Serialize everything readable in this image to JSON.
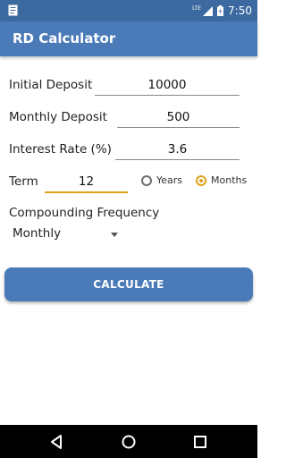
{
  "status_bar": {
    "time": "7:50",
    "network_label": "LTE",
    "icons": [
      "notification-icon",
      "signal-icon",
      "battery-icon"
    ]
  },
  "app_bar": {
    "title": "RD Calculator"
  },
  "form": {
    "initial_deposit": {
      "label": "Initial Deposit",
      "value": "10000"
    },
    "monthly_deposit": {
      "label": "Monthly Deposit",
      "value": "500"
    },
    "interest_rate": {
      "label": "Interest Rate (%)",
      "value": "3.6"
    },
    "term": {
      "label": "Term",
      "value": "12",
      "options": [
        {
          "label": "Years",
          "selected": false
        },
        {
          "label": "Months",
          "selected": true
        }
      ]
    },
    "compounding": {
      "label": "Compounding Frequency",
      "selected": "Monthly"
    }
  },
  "calculate_button": {
    "label": "CALCULATE"
  },
  "colors": {
    "status_bar": "#3c6aa0",
    "app_bar": "#4a7ab7",
    "accent": "#e0a21a",
    "button": "#4a7ab7"
  },
  "nav_bar": {
    "icons": [
      "back-icon",
      "home-icon",
      "recents-icon"
    ]
  }
}
